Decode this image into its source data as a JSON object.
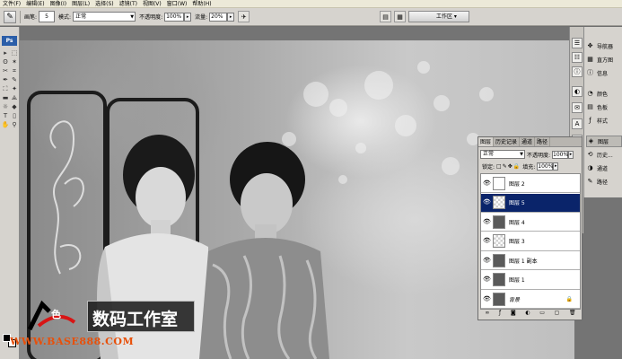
{
  "menu": [
    "文件(F)",
    "编辑(E)",
    "图像(I)",
    "图层(L)",
    "选择(S)",
    "滤镜(T)",
    "视图(V)",
    "窗口(W)",
    "帮助(H)"
  ],
  "options": {
    "brush_label": "画笔:",
    "brush_size": "5",
    "mode_label": "模式:",
    "mode_value": "正常",
    "opacity_label": "不透明度:",
    "opacity_value": "100%",
    "flow_label": "流量:",
    "flow_value": "20%",
    "workspace_label": "工作区 ▾"
  },
  "toolbox": {
    "logo": "Ps",
    "tools": [
      "▸",
      "⬚",
      "ʘ",
      "✶",
      "✂",
      "⌗",
      "✒",
      "✎",
      "⛶",
      "✦",
      "▬",
      "⟁",
      "☼",
      "◆",
      "T",
      "▯",
      "✋",
      "⚲"
    ]
  },
  "dock_icons": [
    "☰",
    "☷",
    "ⓘ",
    "◐",
    "✉",
    "A",
    "¶"
  ],
  "panels": {
    "items": [
      {
        "icon": "✥",
        "label": "导航器"
      },
      {
        "icon": "▦",
        "label": "直方图"
      },
      {
        "icon": "ⓘ",
        "label": "信息"
      },
      {
        "icon": "◔",
        "label": "颜色"
      },
      {
        "icon": "▤",
        "label": "色板"
      },
      {
        "icon": "ƒ",
        "label": "样式"
      },
      {
        "icon": "◈",
        "label": "图层"
      },
      {
        "icon": "⟲",
        "label": "历史..."
      },
      {
        "icon": "◑",
        "label": "通道"
      },
      {
        "icon": "✎",
        "label": "路径"
      }
    ]
  },
  "layers_panel": {
    "tabs": [
      "图层",
      "历史记录",
      "通道",
      "路径"
    ],
    "blend_mode": "正常",
    "opacity_label": "不透明度:",
    "opacity_value": "100%",
    "lock_label": "锁定:",
    "fill_label": "填充:",
    "fill_value": "100%",
    "layers": [
      {
        "name": "图层 2",
        "thumb": "blank",
        "selected": false
      },
      {
        "name": "图层 5",
        "thumb": "check",
        "selected": true
      },
      {
        "name": "图层 4",
        "thumb": "dark",
        "selected": false
      },
      {
        "name": "图层 3",
        "thumb": "check",
        "selected": false
      },
      {
        "name": "图层 1 副本",
        "thumb": "dark",
        "selected": false
      },
      {
        "name": "图层 1",
        "thumb": "dark",
        "selected": false
      },
      {
        "name": "背景",
        "thumb": "dark",
        "selected": false
      }
    ]
  },
  "watermark": {
    "char": "色",
    "title": "数码工作室",
    "url": "WWW.BASE888.COM"
  }
}
